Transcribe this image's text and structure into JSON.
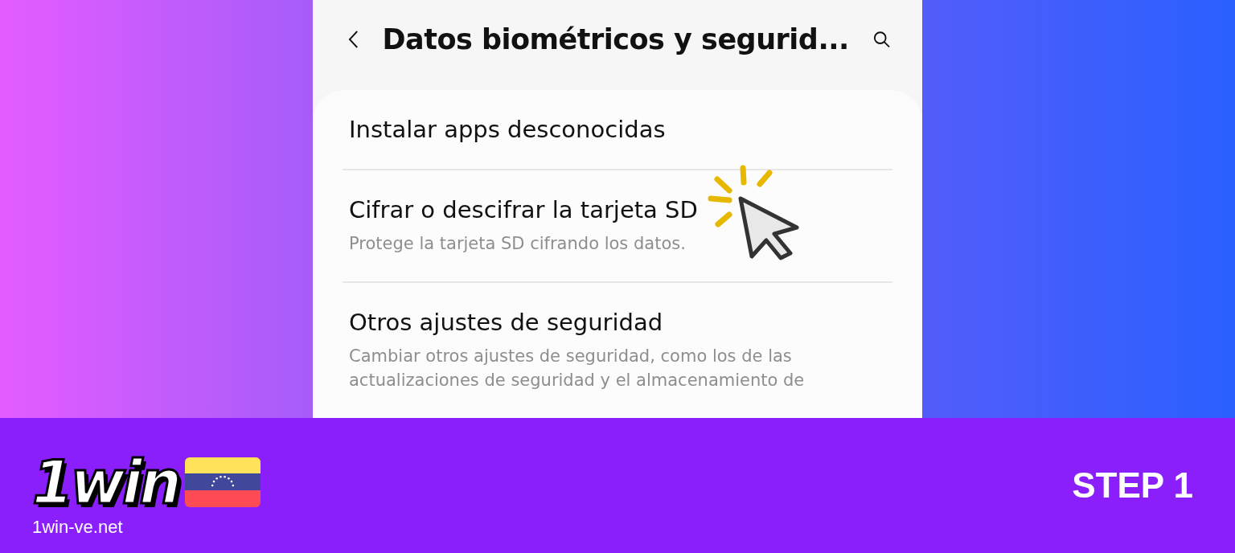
{
  "phone": {
    "title": "Datos biométricos y segurid...",
    "items": [
      {
        "title": "Instalar apps desconocidas"
      },
      {
        "title": "Cifrar o descifrar la tarjeta SD",
        "lines": [
          "Protege la tarjeta SD cifrando los datos."
        ]
      },
      {
        "title": "Otros ajustes de seguridad",
        "lines": [
          "Cambiar otros ajustes de seguridad, como los de las",
          "actualizaciones de seguridad y el almacenamiento de"
        ]
      }
    ]
  },
  "footer": {
    "logo": "1win",
    "site": "1win-ve.net",
    "step": "STEP 1"
  }
}
